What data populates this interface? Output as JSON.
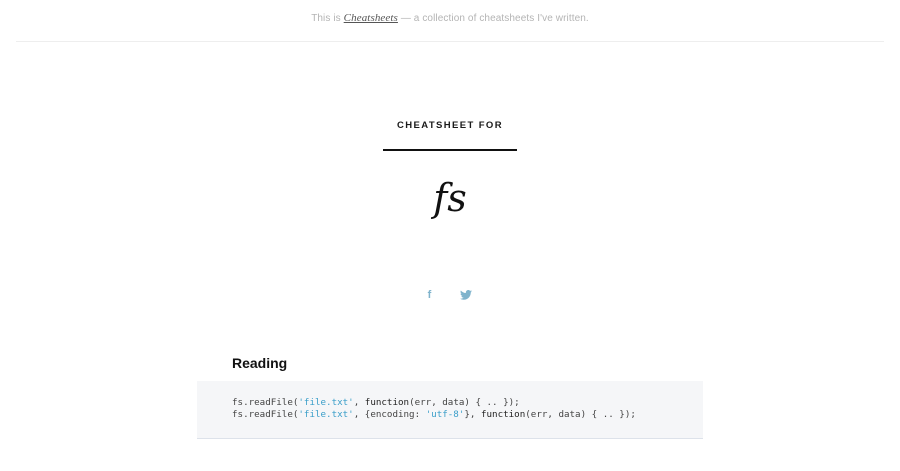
{
  "topbar": {
    "intro_prefix": "This is ",
    "intro_link": "Cheatsheets",
    "intro_suffix": " — a collection of cheatsheets I've written."
  },
  "header": {
    "eyebrow": "CHEATSHEET FOR",
    "title": "fs"
  },
  "social": {
    "facebook_label": "f",
    "twitter_icon": "twitter-bird-icon"
  },
  "section": {
    "title": "Reading",
    "code_lines": [
      [
        {
          "t": "fs.readFile(",
          "c": "plain"
        },
        {
          "t": "'file.txt'",
          "c": "str"
        },
        {
          "t": ", ",
          "c": "plain"
        },
        {
          "t": "function",
          "c": "kw"
        },
        {
          "t": "(err, data) { .. });",
          "c": "plain"
        }
      ],
      [
        {
          "t": "fs.readFile(",
          "c": "plain"
        },
        {
          "t": "'file.txt'",
          "c": "str"
        },
        {
          "t": ", {encoding: ",
          "c": "plain"
        },
        {
          "t": "'utf-8'",
          "c": "str"
        },
        {
          "t": "}, ",
          "c": "plain"
        },
        {
          "t": "function",
          "c": "kw"
        },
        {
          "t": "(err, data) { .. });",
          "c": "plain"
        }
      ]
    ]
  },
  "colors": {
    "string": "#3a9ec9",
    "social": "#7fb3cc",
    "code_bg": "#f5f6f8"
  }
}
